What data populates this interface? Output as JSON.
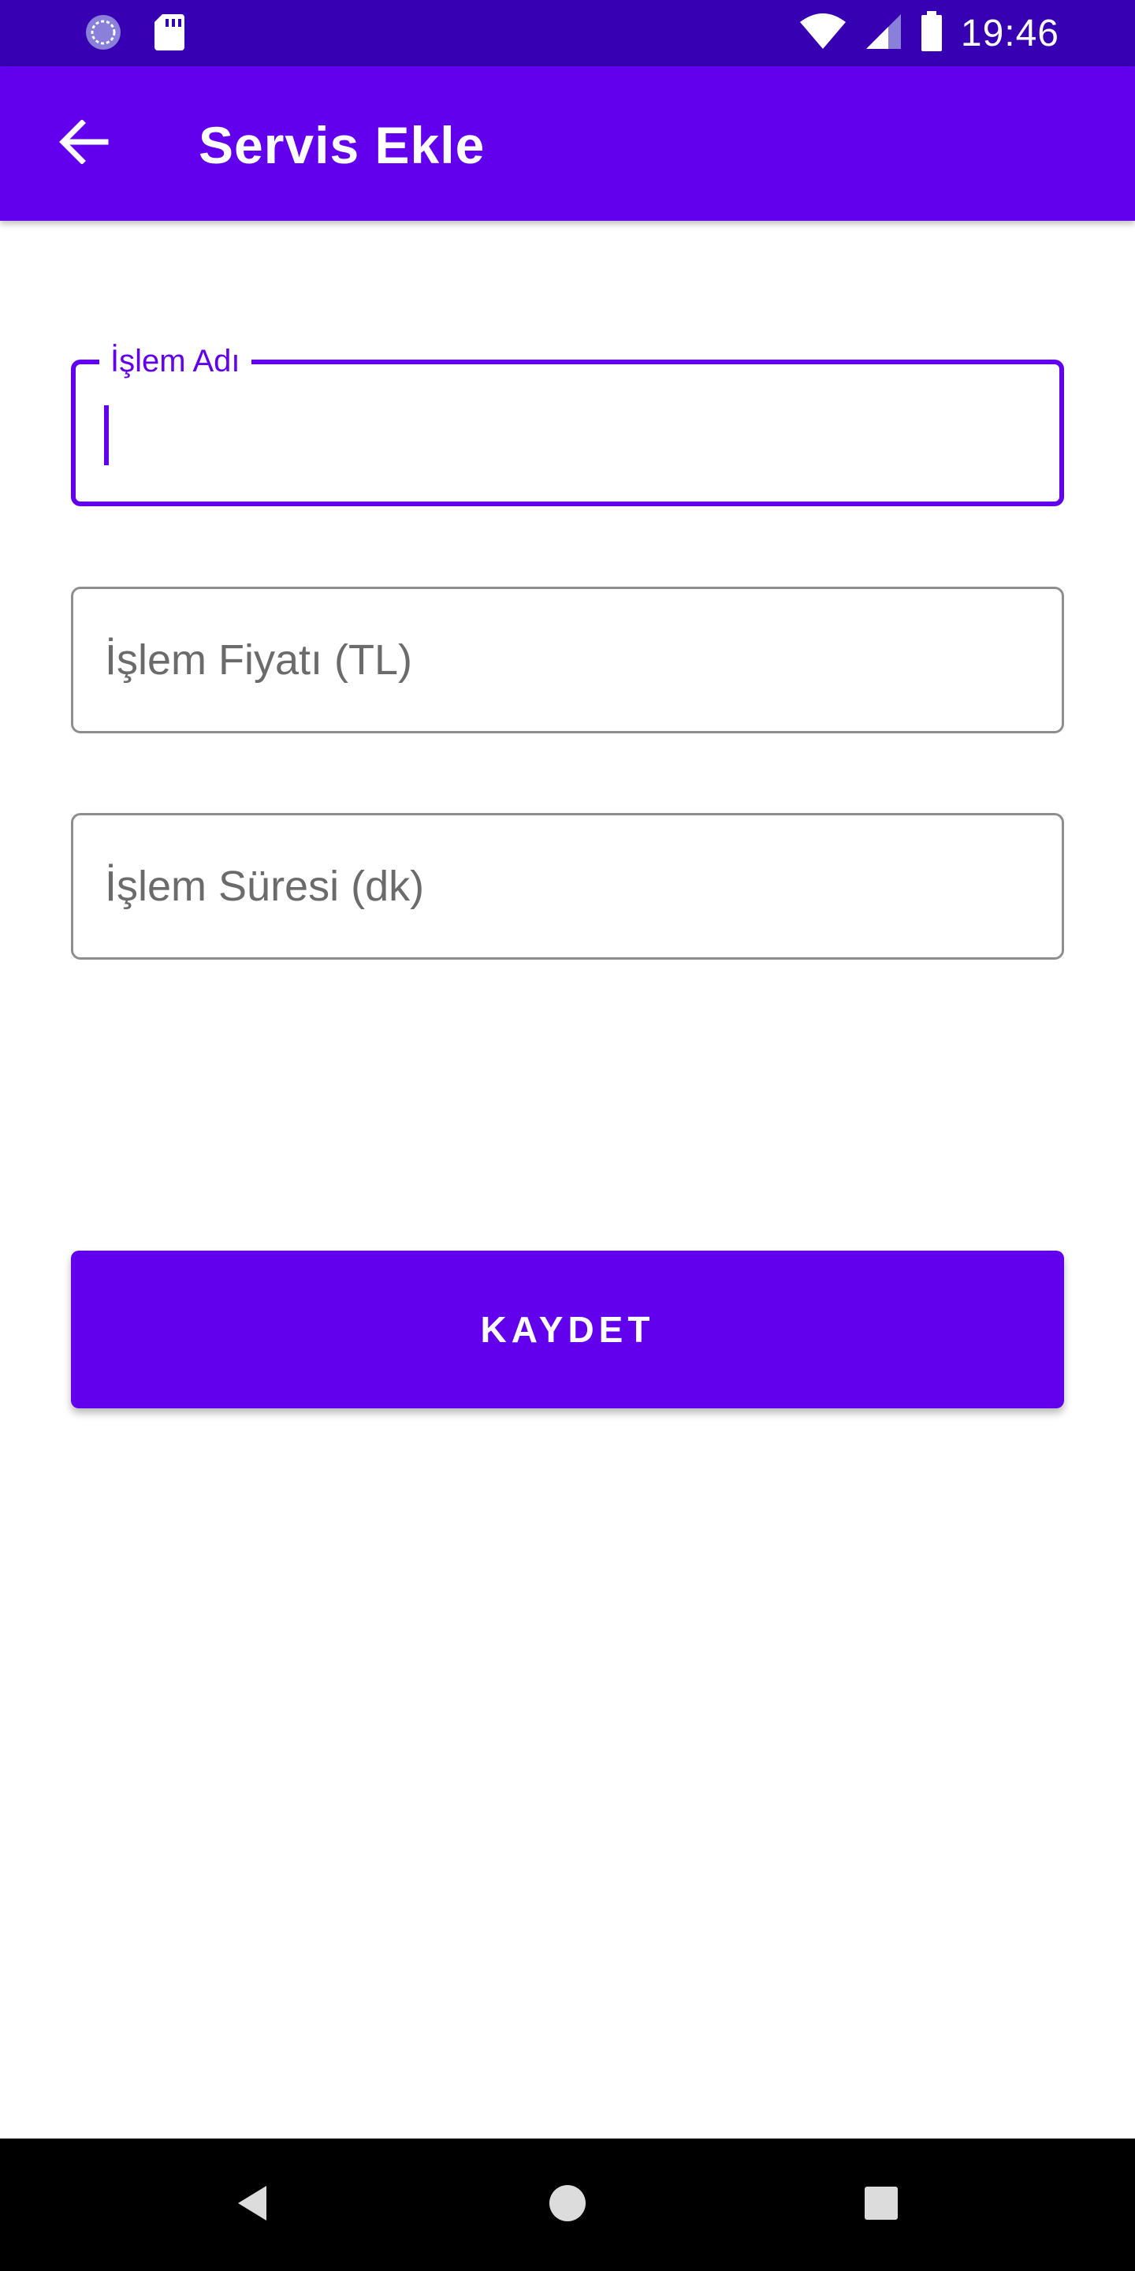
{
  "status_bar": {
    "time": "19:46",
    "icons": [
      "sync-icon",
      "sd-card-icon",
      "wifi-icon",
      "signal-icon",
      "battery-icon"
    ]
  },
  "app_bar": {
    "title": "Servis Ekle",
    "back_icon": "arrow-back-icon"
  },
  "form": {
    "name_field": {
      "label": "İşlem Adı",
      "value": ""
    },
    "price_field": {
      "placeholder": "İşlem Fiyatı (TL)",
      "value": ""
    },
    "duration_field": {
      "placeholder": "İşlem Süresi (dk)",
      "value": ""
    },
    "save_label": "KAYDET"
  },
  "nav_bar": {
    "icons": [
      "back-triangle-icon",
      "home-circle-icon",
      "recents-square-icon"
    ]
  },
  "colors": {
    "primary": "#6200ee",
    "primary_dark": "#3700b3",
    "outline": "#8e8e8e"
  }
}
